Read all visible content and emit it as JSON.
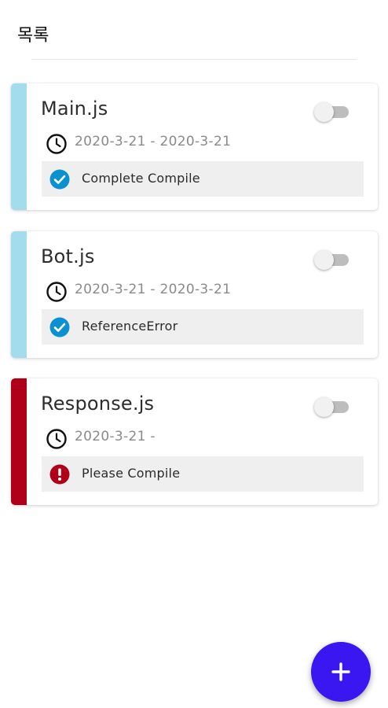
{
  "header": {
    "title": "목록"
  },
  "colors": {
    "ok_stripe": "#a3dced",
    "error_stripe": "#b00018",
    "check_icon": "#0b90d0",
    "error_icon": "#b00018",
    "fab": "#3a16f0"
  },
  "cards": [
    {
      "file_name": "Main.js",
      "date_range": "2020-3-21 - 2020-3-21",
      "status_text": "Complete Compile",
      "status": "ok",
      "toggle_on": false
    },
    {
      "file_name": "Bot.js",
      "date_range": "2020-3-21 - 2020-3-21",
      "status_text": "ReferenceError",
      "status": "ok",
      "toggle_on": false
    },
    {
      "file_name": "Response.js",
      "date_range": "2020-3-21 -",
      "status_text": "Please Compile",
      "status": "error",
      "toggle_on": false
    }
  ],
  "fab": {
    "label": "+",
    "icon": "plus-icon"
  }
}
